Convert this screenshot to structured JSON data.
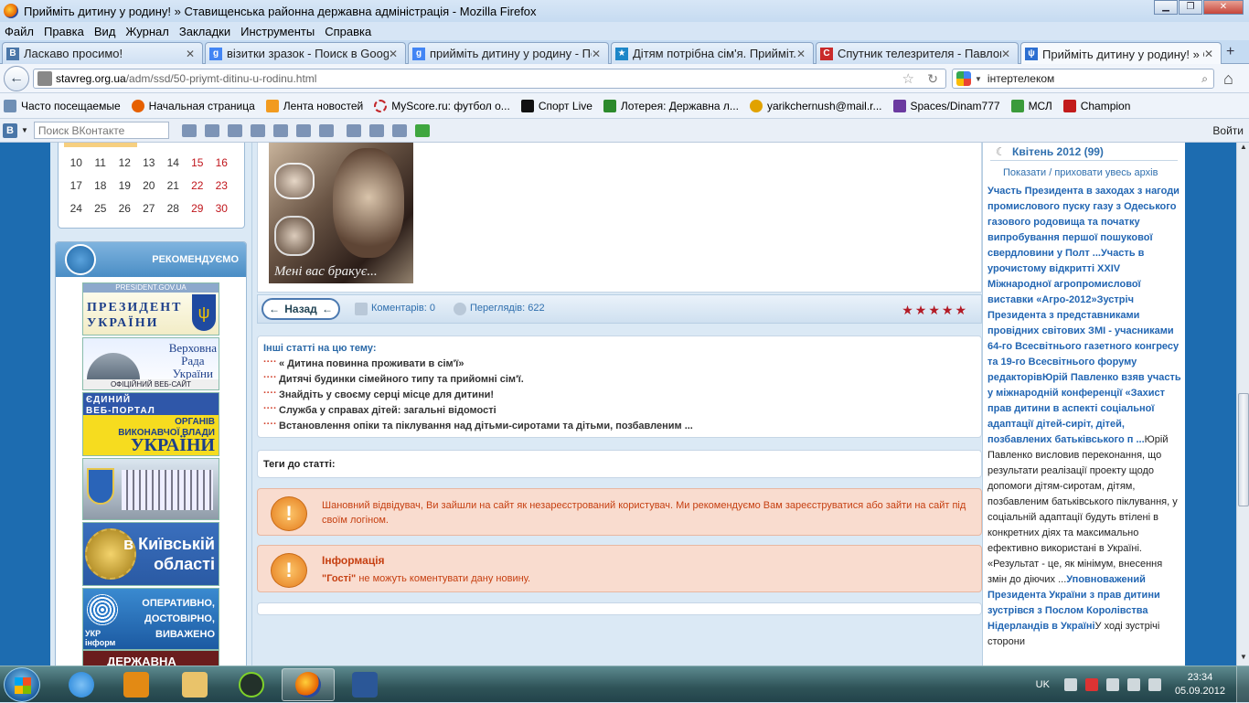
{
  "window": {
    "title": "Прийміть дитину у родину! » Ставищенська районна державна адміністрація - Mozilla Firefox"
  },
  "menu": [
    "Файл",
    "Правка",
    "Вид",
    "Журнал",
    "Закладки",
    "Инструменты",
    "Справка"
  ],
  "tabs": [
    {
      "label": "Ласкаво просимо!",
      "icon": "vk-icon",
      "color": "#4a76a8",
      "glyph": "B"
    },
    {
      "label": "візитки зразок - Поиск в Google",
      "icon": "google-icon",
      "color": "#4285f4",
      "glyph": "g"
    },
    {
      "label": "прийміть дитину у родину - По...",
      "icon": "google-icon",
      "color": "#4285f4",
      "glyph": "g"
    },
    {
      "label": "Дітям потрібна сім'я. Прийміт...",
      "icon": "flag-icon",
      "color": "#1c86c8",
      "glyph": "★"
    },
    {
      "label": "Спутник телезрителя - Павлог...",
      "icon": "sputnik-icon",
      "color": "#c92a2a",
      "glyph": "C"
    },
    {
      "label": "Прийміть дитину у родину! » С...",
      "icon": "ua-trident-icon",
      "color": "#2d6fd1",
      "glyph": "ψ"
    }
  ],
  "url": {
    "host": "stavreg.org.ua",
    "path": "/adm/ssd/50-priymt-ditinu-u-rodinu.html"
  },
  "search": {
    "value": "інтертелеком"
  },
  "bookmarks": [
    {
      "label": "Часто посещаемые",
      "color": "#6f8fb5"
    },
    {
      "label": "Начальная страница",
      "color": "#e66000"
    },
    {
      "label": "Лента новостей",
      "color": "#f29b1f"
    },
    {
      "label": "MyScore.ru: футбол о...",
      "color": "#c3272b"
    },
    {
      "label": "Спорт Live",
      "color": "#111111"
    },
    {
      "label": "Лотерея: Державна л...",
      "color": "#2c8a2c"
    },
    {
      "label": "yarikchernush@mail.r...",
      "color": "#e1a200"
    },
    {
      "label": "Spaces/Dinam777",
      "color": "#6b3aa0"
    },
    {
      "label": "МСЛ",
      "color": "#3b9b3b"
    },
    {
      "label": "Champion",
      "color": "#c21b1b"
    }
  ],
  "vk": {
    "logo": "B",
    "placeholder": "Поиск ВКонтакте",
    "exit": "Войти"
  },
  "calendar": {
    "rows": [
      [
        "10",
        "11",
        "12",
        "13",
        "14",
        "15",
        "16"
      ],
      [
        "17",
        "18",
        "19",
        "20",
        "21",
        "22",
        "23"
      ],
      [
        "24",
        "25",
        "26",
        "27",
        "28",
        "29",
        "30"
      ]
    ]
  },
  "recommend": {
    "title": "РЕКОМЕНДУЄМО",
    "president": {
      "url": "PRESIDENT.GOV.UA",
      "line1": "ПРЕЗИДЕНТ",
      "line2": "УКРАЇНИ"
    },
    "rada": {
      "line1": "Верховна",
      "line2": "Рада",
      "line3": "України",
      "sub": "ОФІЦІЙНИЙ ВЕБ-САЙТ"
    },
    "portal": {
      "line1": "ЄДИНИЙ",
      "line2": "ВЕБ-ПОРТАЛ",
      "line3": "ОРГАНІВ",
      "line4": "ВИКОНАВЧОЇ ВЛАДИ",
      "line5": "УКРАЇНИ"
    },
    "kyiv": {
      "line1": "в Київській",
      "line2": "області"
    },
    "ukrinform": {
      "logo1": "УКР",
      "logo2": "інформ",
      "line1": "ОПЕРАТИВНО,",
      "line2": "ДОСТОВІРНО,",
      "line3": "ВИВАЖЕНО"
    },
    "last": "ДЕРЖАВНА"
  },
  "photo": {
    "caption": "Мені вас бракує..."
  },
  "actions": {
    "back": "Назад",
    "comments": "Коментарів: 0",
    "views": "Переглядів: 622",
    "rating": 5
  },
  "related": {
    "heading": "Інші статті на цю тему:",
    "items": [
      "« Дитина повинна проживати в сім'ї»",
      "Дитячі будинки сімейного типу та прийомні сім'ї.",
      "Знайдіть у своєму серці місце для дитини!",
      "Служба у справах дітей: загальні відомості",
      "Встановлення опіки та піклування над дітьми-сиротами та дітьми, позбавленим ..."
    ]
  },
  "tags": {
    "label": "Теги до статті:"
  },
  "notice1": {
    "text": "Шановний відвідувач, Ви зайшли на сайт як незареєстрований користувач. Ми рекомендуємо Вам зареєструватися або зайти на сайт під своїм логіном."
  },
  "notice2": {
    "title": "Інформація",
    "guests": "\"Гості\"",
    "text": " не можуть коментувати дану новину."
  },
  "archive": {
    "heading": "Квітень 2012 (99)",
    "toggle": "Показати / приховати увесь архів",
    "p1": "Участь Президента в заходах з нагоди промислового пуску газу з Одеського газового родовища та початку випробування першої пошукової свердловини у Полт",
    "p2": "...Участь в урочистому відкритті XXIV Міжнародної агропромислової виставки «Агро-2012»Зустріч Президента з представниками провідних світових ЗМІ - учасниками 64-го Всесвітнього газетного конгресу та 19-го Всесвітнього форуму редакторівЮрій Павленко взяв участь у міжнародній конференції «Захист прав дитини в аспекті соціальної адаптації дітей-сиріт, дітей, позбавлених батьківського п",
    "p3": " ...",
    "p4": "Юрій Павленко висловив переконання, що результати реалізації проекту щодо допомоги дітям-сиротам, дітям, позбавленим батьківського піклування, у соціальній адаптації будуть втілені в конкретних діях та максимально ефективно використані в Україні. «Результат - це, як мінімум, внесення змін до діючих ",
    "p5": "...",
    "p6": "Уповноважений Президента України з прав дитини зустрівся з Послом Королівства Нідерландів в Україні",
    "p7": "У ході зустрічі сторони"
  },
  "taskbar": {
    "lang": "UK",
    "time": "23:34",
    "date": "05.09.2012",
    "apps": [
      {
        "name": "ie-taskbar-icon",
        "color": "#1e7fd6"
      },
      {
        "name": "media-player-taskbar-icon",
        "color": "#e38a14"
      },
      {
        "name": "explorer-taskbar-icon",
        "color": "#e9c36a"
      },
      {
        "name": "app-taskbar-icon",
        "color": "#23312a"
      },
      {
        "name": "firefox-taskbar-icon",
        "color": "#e66000"
      },
      {
        "name": "word-taskbar-icon",
        "color": "#2b5797"
      }
    ]
  }
}
